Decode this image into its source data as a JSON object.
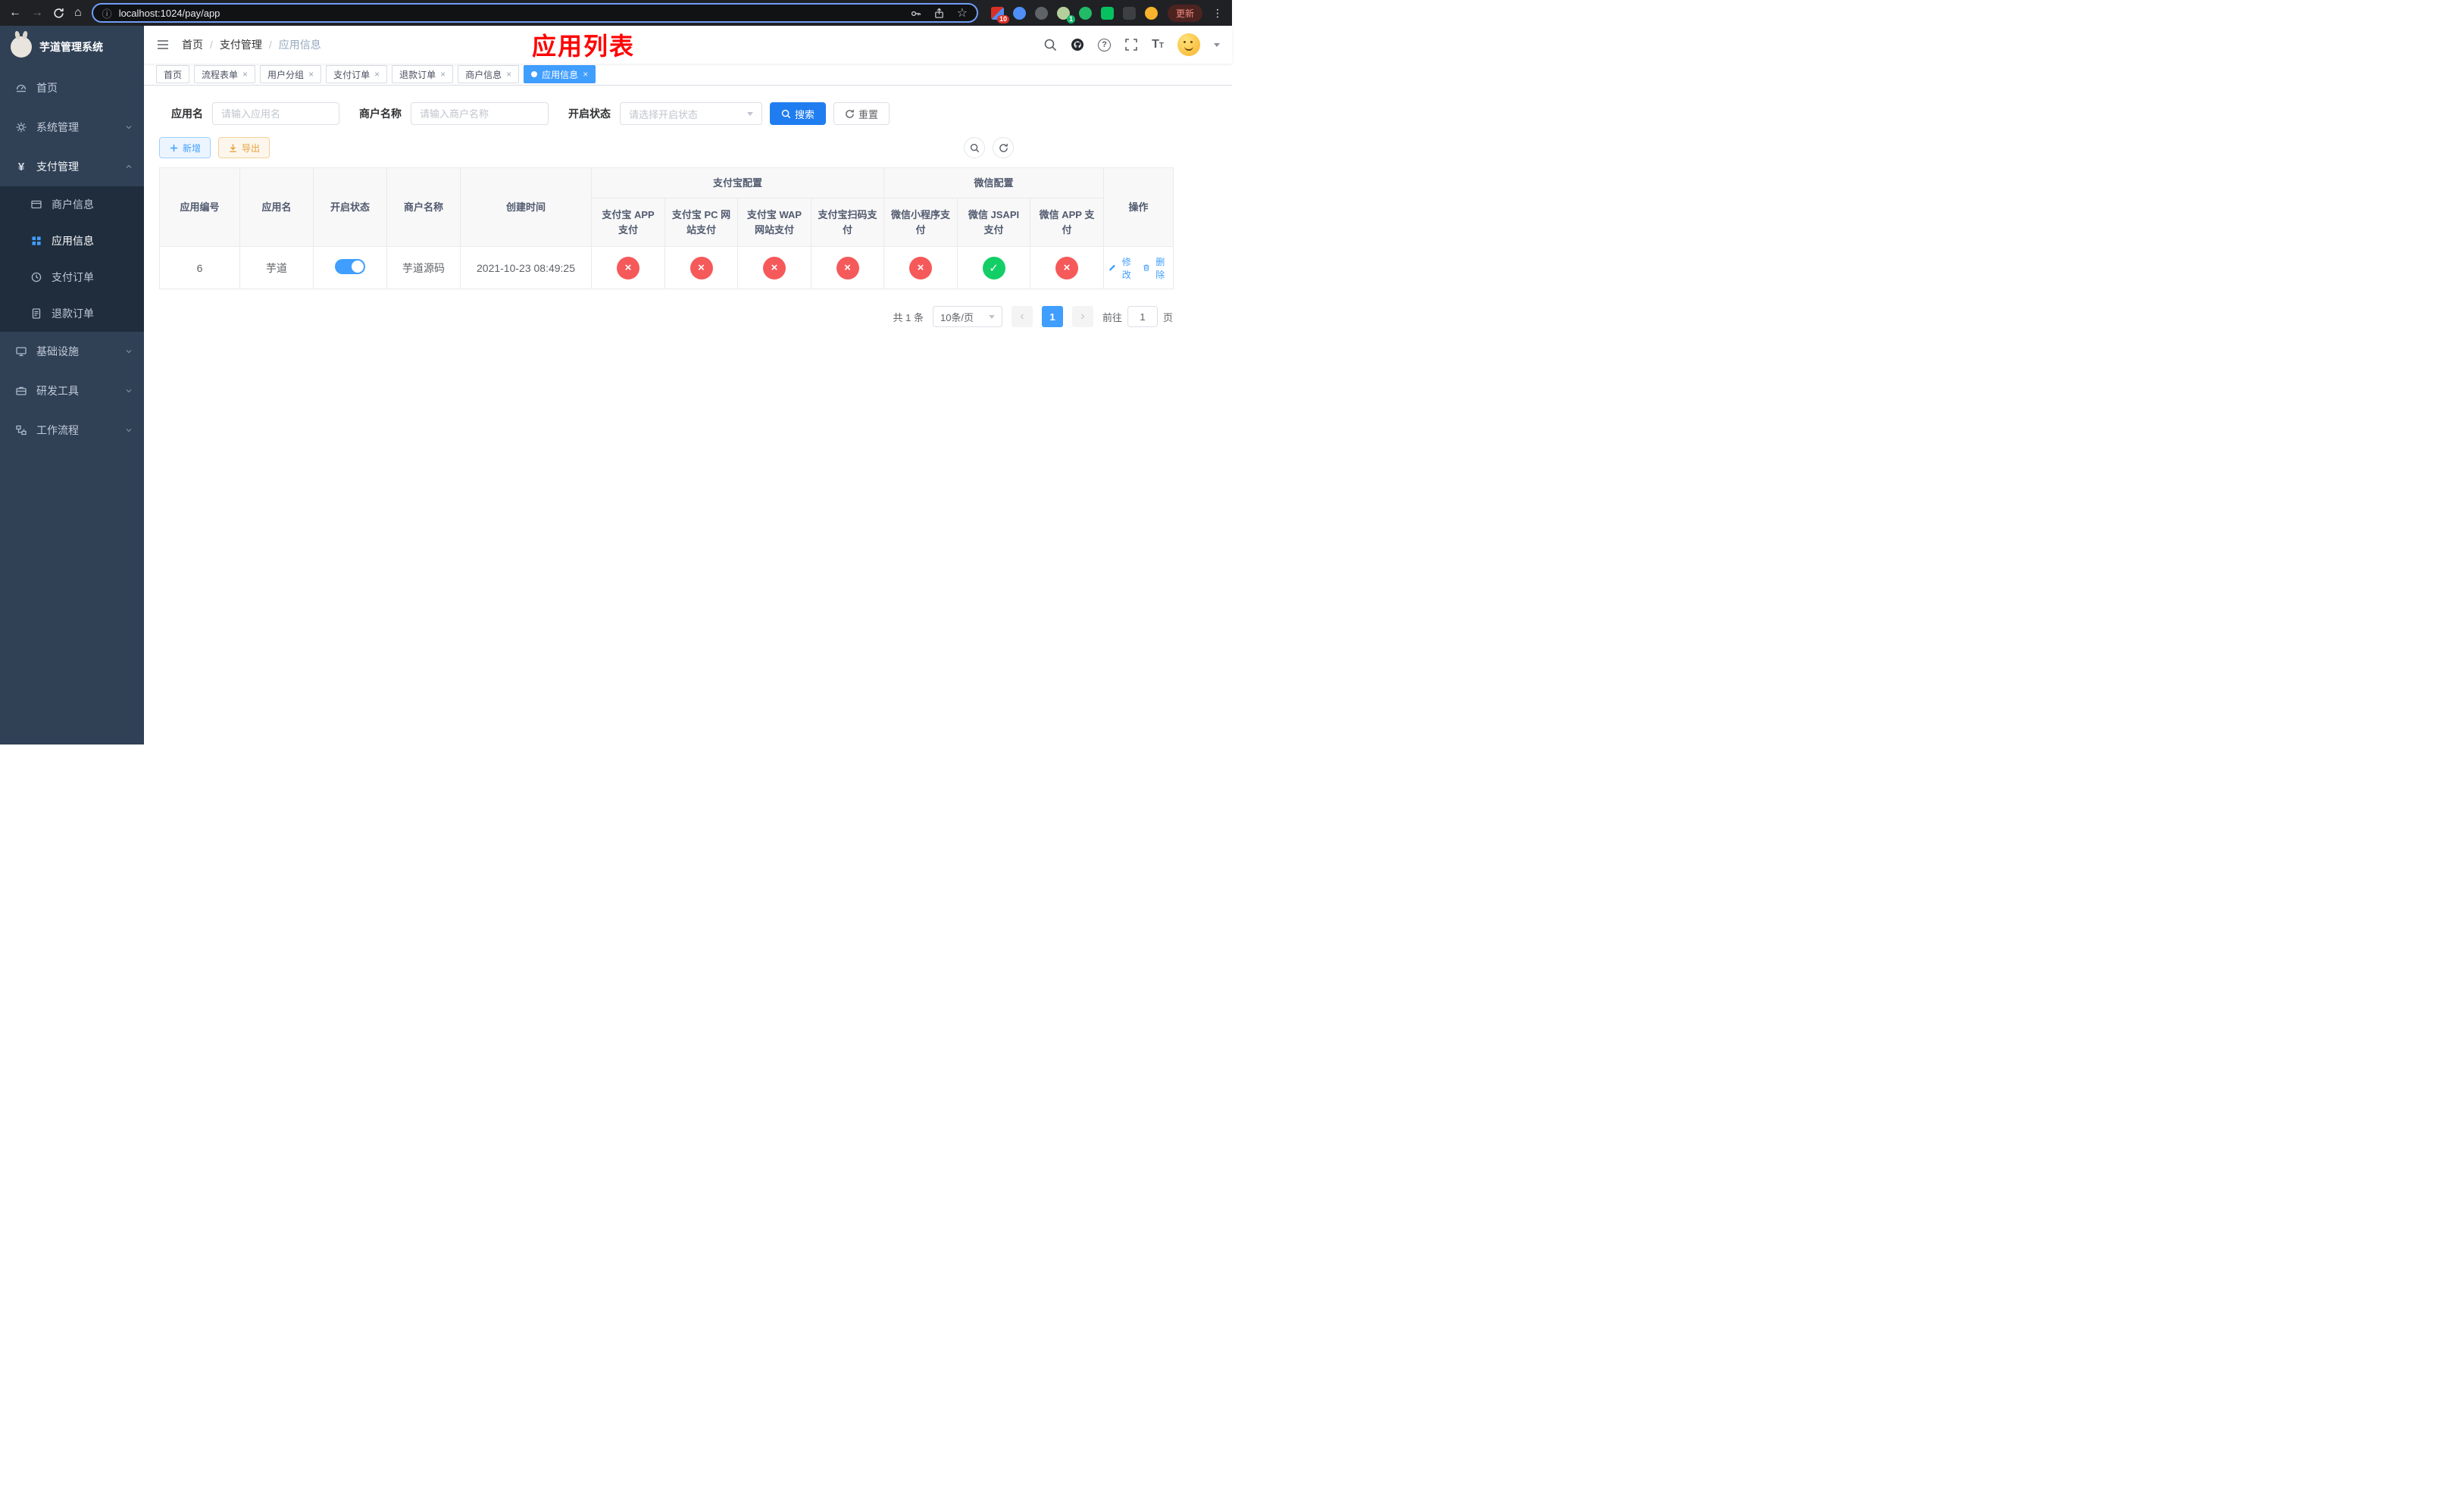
{
  "browser": {
    "url": "localhost:1024/pay/app",
    "update_label": "更新",
    "extension_badge": "10",
    "profile_badge": "1"
  },
  "sidebar": {
    "title": "芋道管理系统",
    "items": [
      {
        "label": "首页"
      },
      {
        "label": "系统管理"
      },
      {
        "label": "支付管理",
        "children": [
          {
            "label": "商户信息"
          },
          {
            "label": "应用信息"
          },
          {
            "label": "支付订单"
          },
          {
            "label": "退款订单"
          }
        ]
      },
      {
        "label": "基础设施"
      },
      {
        "label": "研发工具"
      },
      {
        "label": "工作流程"
      }
    ]
  },
  "header": {
    "breadcrumb": [
      "首页",
      "支付管理",
      "应用信息"
    ],
    "title": "应用列表"
  },
  "tabs": [
    {
      "label": "首页"
    },
    {
      "label": "流程表单"
    },
    {
      "label": "用户分组"
    },
    {
      "label": "支付订单"
    },
    {
      "label": "退款订单"
    },
    {
      "label": "商户信息"
    },
    {
      "label": "应用信息"
    }
  ],
  "filters": {
    "app_name_label": "应用名",
    "app_name_placeholder": "请输入应用名",
    "merchant_label": "商户名称",
    "merchant_placeholder": "请输入商户名称",
    "status_label": "开启状态",
    "status_placeholder": "请选择开启状态",
    "search_label": "搜索",
    "reset_label": "重置"
  },
  "toolbar": {
    "add_label": "新增",
    "export_label": "导出"
  },
  "table": {
    "headers": {
      "app_id": "应用编号",
      "app_name": "应用名",
      "status": "开启状态",
      "merchant": "商户名称",
      "created": "创建时间",
      "alipay_group": "支付宝配置",
      "wechat_group": "微信配置",
      "alipay_app": "支付宝 APP 支付",
      "alipay_pc": "支付宝 PC 网站支付",
      "alipay_wap": "支付宝 WAP 网站支付",
      "alipay_qr": "支付宝扫码支付",
      "wechat_mini": "微信小程序支付",
      "wechat_jsapi": "微信 JSAPI 支付",
      "wechat_app": "微信 APP 支付",
      "actions": "操作"
    },
    "rows": [
      {
        "app_id": "6",
        "app_name": "芋道",
        "enabled": true,
        "merchant": "芋道源码",
        "created": "2021-10-23 08:49:25",
        "channels": [
          false,
          false,
          false,
          false,
          false,
          true,
          false
        ],
        "edit_label": "修改",
        "delete_label": "删除"
      }
    ]
  },
  "pagination": {
    "total": "共 1 条",
    "page_size": "10条/页",
    "current_page": "1",
    "goto_label": "前往",
    "goto_value": "1",
    "page_suffix": "页"
  },
  "colors": {
    "accent": "#409eff",
    "danger": "#f6595a",
    "success": "#13ce66",
    "warning": "#e6a23c",
    "annotation_red": "#ff0000",
    "sidebar_bg": "#304156",
    "submenu_bg": "#1f2d3d"
  }
}
